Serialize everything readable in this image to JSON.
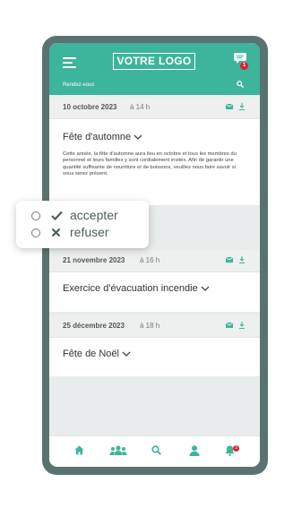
{
  "header": {
    "logo_text": "VOTRE LOGO",
    "chat_badge": "1",
    "section_label": "Rendez-vous"
  },
  "events": [
    {
      "date": "10 octobre 2023",
      "time": "à 14 h",
      "title": "Fête d'automne",
      "description": "Cette année, la fête d'automne aura lieu en octobre et tous les membres du personnel et leurs familles y sont cordialement invités. Afin de garantir une quantité suffisante de nourriture et de boissons, veuillez nous faire savoir si vous serez présent."
    },
    {
      "date": "21 novembre 2023",
      "time": "à 16 h",
      "title": "Exercice d'évacuation incendie"
    },
    {
      "date": "25 décembre 2023",
      "time": "à 18 h",
      "title": "Fête de Noël"
    }
  ],
  "popup": {
    "accept_label": "accepter",
    "refuse_label": "refuser"
  },
  "nav": {
    "items": [
      "home-icon",
      "group-icon",
      "search-icon",
      "profile-icon",
      "bell-icon"
    ],
    "notification_badge": "3"
  },
  "colors": {
    "accent": "#3cb59c",
    "phone_frame": "#5a7370",
    "badge": "#d9232e"
  }
}
